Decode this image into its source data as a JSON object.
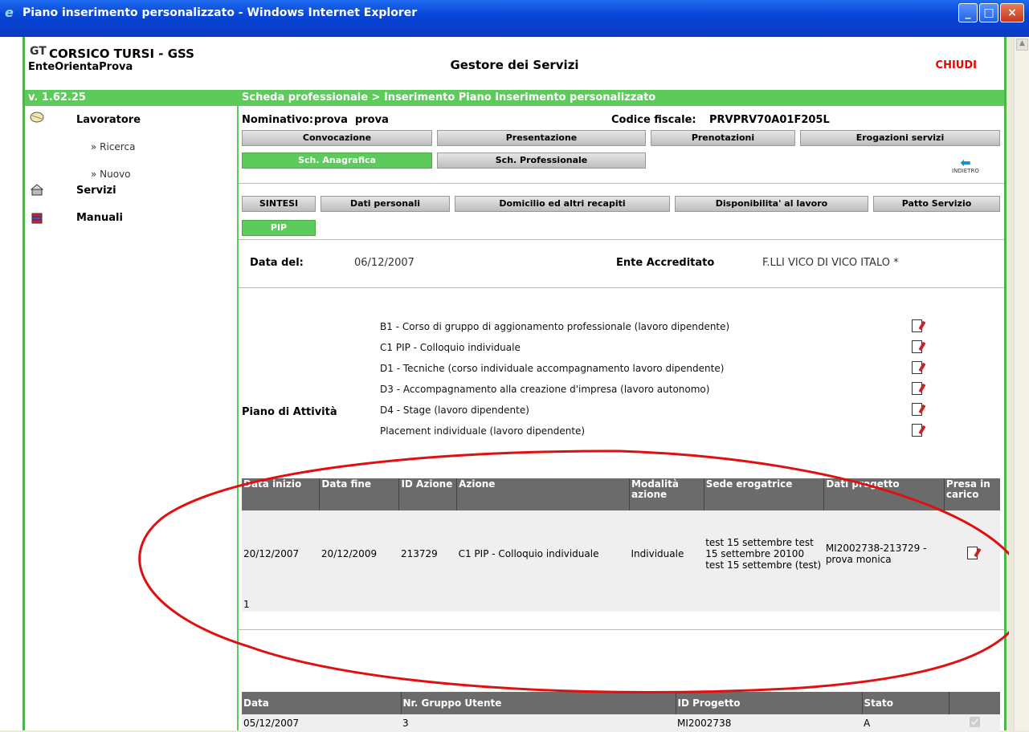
{
  "window": {
    "title": "Piano inserimento personalizzato - Windows Internet Explorer",
    "btn_min": "_",
    "btn_max": "□",
    "btn_close": "×"
  },
  "header": {
    "logo_mark": "GT",
    "app_name": "CORSICO TURSI - GSS",
    "ente": "EnteOrientaProva",
    "center_title": "Gestore dei Servizi",
    "close_label": "CHIUDI",
    "version": "v. 1.62.25",
    "breadcrumb": "Scheda professionale > Inserimento Piano Inserimento personalizzato"
  },
  "sidebar": {
    "lavoratore": "Lavoratore",
    "ricerca": "» Ricerca",
    "nuovo": "» Nuovo",
    "servizi": "Servizi",
    "manuali": "Manuali"
  },
  "person": {
    "nominativo_label": "Nominativo:",
    "nominativo_value": "prova  prova",
    "cf_label": "Codice fiscale:",
    "cf_value": "PRVPRV70A01F205L"
  },
  "tabs_main": [
    "Convocazione",
    "Presentazione",
    "Prenotazioni",
    "Erogazioni servizi",
    "Sch. Anagrafica",
    "Sch. Professionale"
  ],
  "indietro_label": "INDIETRO",
  "tabs_sub": [
    "SINTESI",
    "Dati personali",
    "Domicilio ed altri recapiti",
    "Disponibilita' al lavoro",
    "Patto Servizio",
    "PIP"
  ],
  "info": {
    "data_label": "Data del:",
    "data_value": "06/12/2007",
    "ente_label": "Ente Accreditato",
    "ente_value": "F.LLI VICO DI VICO ITALO *"
  },
  "piano": {
    "label": "Piano di Attività",
    "activities": [
      "B1 - Corso di gruppo di aggionamento professionale (lavoro dipendente)",
      "C1 PIP - Colloquio individuale",
      "D1 - Tecniche (corso individuale accompagnamento lavoro dipendente)",
      "D3 - Accompagnamento alla creazione d'impresa (lavoro autonomo)",
      "D4 - Stage (lavoro dipendente)",
      "Placement individuale (lavoro dipendente)"
    ]
  },
  "azioni_table": {
    "headers": [
      "Data inizio",
      "Data fine",
      "ID Azione",
      "Azione",
      "Modalità azione",
      "Sede erogatrice",
      "Dati progetto",
      "Presa in carico"
    ],
    "row": {
      "inizio": "20/12/2007",
      "fine": "20/12/2009",
      "id": "213729",
      "azione": "C1 PIP - Colloquio individuale",
      "modalita": "Individuale",
      "sede": "test 15 settembre test 15 settembre 20100 test 15 settembre (test)",
      "progetto": "MI2002738-213729 - prova monica"
    },
    "count": "1"
  },
  "progetti_table": {
    "headers": [
      "Data",
      "Nr. Gruppo Utente",
      "ID Progetto",
      "Stato",
      ""
    ],
    "row": {
      "data": "05/12/2007",
      "gruppo": "3",
      "progetto": "MI2002738",
      "stato": "A"
    }
  },
  "annotation_color": "#e01010"
}
